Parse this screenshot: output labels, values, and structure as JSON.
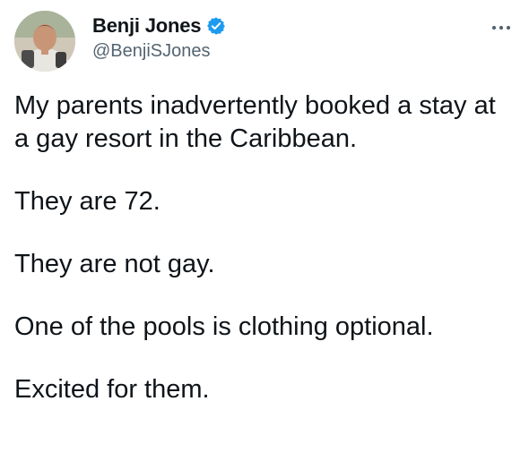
{
  "author": {
    "display_name": "Benji Jones",
    "handle": "@BenjiSJones",
    "verified": true
  },
  "icons": {
    "verified": "verified-badge-icon",
    "more": "more-options-icon"
  },
  "colors": {
    "text": "#0f1419",
    "secondary_text": "#536471",
    "verified_blue": "#1d9bf0"
  },
  "tweet": {
    "lines": [
      "My parents inadvertently booked a stay at a gay resort in the Caribbean.",
      "They are 72.",
      "They are not gay.",
      "One of the pools is clothing optional.",
      "Excited for them."
    ]
  }
}
